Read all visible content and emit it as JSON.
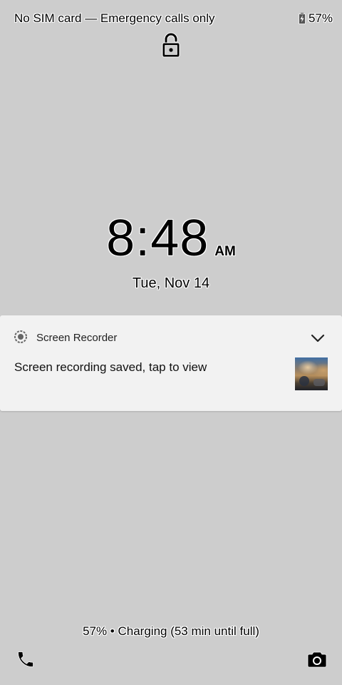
{
  "status_bar": {
    "carrier_text": "No SIM card — Emergency calls only",
    "battery_percent": "57%",
    "battery_icon": "battery-charging-icon"
  },
  "lock": {
    "icon": "lock-icon"
  },
  "clock": {
    "time": "8:48",
    "ampm": "AM",
    "date": "Tue, Nov 14"
  },
  "notification": {
    "app_icon": "screen-recorder-icon",
    "app_name": "Screen Recorder",
    "title": "Screen recording saved, tap to view",
    "expand_icon": "chevron-down-icon"
  },
  "footer": {
    "charging_text": "57% • Charging (53 min until full)",
    "left_shortcut_icon": "phone-icon",
    "right_shortcut_icon": "camera-icon"
  }
}
